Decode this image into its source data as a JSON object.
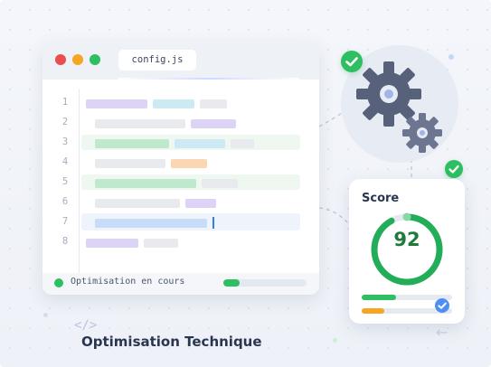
{
  "editor": {
    "file_tab": "config.js",
    "line_numbers": [
      "1",
      "2",
      "3",
      "4",
      "5",
      "6",
      "7",
      "8"
    ],
    "status_text": "Optimisation en cours",
    "progress": 0.2
  },
  "score": {
    "title": "Score",
    "value": "92",
    "ring_progress": 0.92,
    "bar_green": 0.38,
    "bar_orange": 0.25
  },
  "footer": {
    "code_glyph": "</>",
    "title": "Optimisation Technique",
    "arrow_glyph": "←"
  },
  "icons": {
    "gear_large": "gear-icon",
    "gear_small": "gear-icon",
    "check": "check-icon"
  },
  "colors": {
    "green": "#2dbf62",
    "purple": "#dcd3f7",
    "cyan": "#cdeaf4",
    "gray": "#e8eaee",
    "orange": "#fad6b2",
    "blue": "#c7dcf8",
    "gear": "#58617a",
    "blue_accent": "#4f8ef5",
    "orange_accent": "#f5a623"
  }
}
